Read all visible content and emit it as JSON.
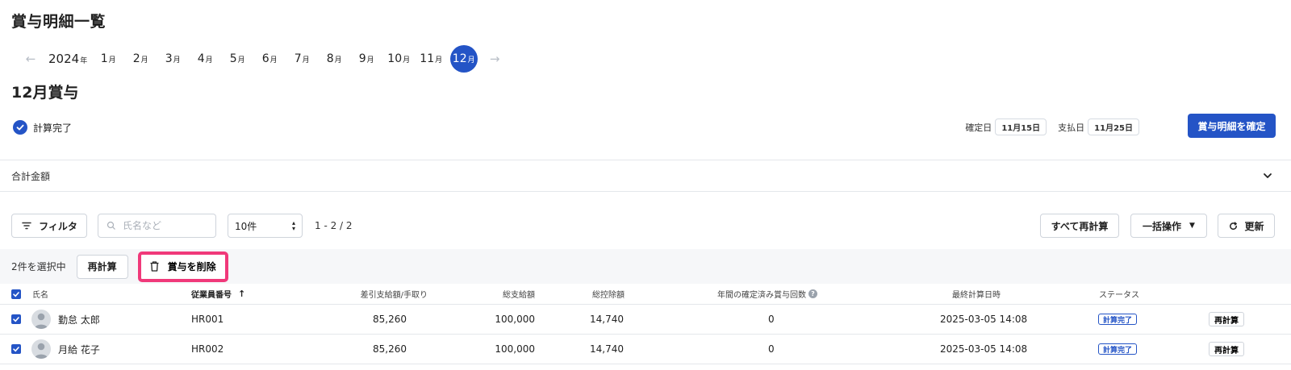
{
  "page": {
    "title": "賞与明細一覧"
  },
  "month_nav": {
    "prev_icon": "arrow-left-icon",
    "next_icon": "arrow-right-icon",
    "year": "2024",
    "year_suffix": "年",
    "month_suffix": "月",
    "months": [
      "1",
      "2",
      "3",
      "4",
      "5",
      "6",
      "7",
      "8",
      "9",
      "10",
      "11",
      "12"
    ],
    "active_month": "12"
  },
  "section": {
    "title": "12月賞与",
    "status": "計算完了",
    "confirm_date_label": "確定日",
    "confirm_date": "11月15日",
    "pay_date_label": "支払日",
    "pay_date": "11月25日",
    "confirm_button": "賞与明細を確定"
  },
  "totals": {
    "label": "合計金額"
  },
  "toolbar": {
    "filter_label": "フィルタ",
    "search_placeholder": "氏名など",
    "per_page": "10件",
    "range": "1 - 2 / 2",
    "recalc_all": "すべて再計算",
    "bulk": "一括操作",
    "refresh": "更新"
  },
  "selection": {
    "count_text": "2件を選択中",
    "recalc": "再計算",
    "delete": "賞与を削除"
  },
  "table": {
    "headers": {
      "name": "氏名",
      "employee_no": "従業員番号",
      "net_pay": "差引支給額/手取り",
      "gross": "総支給額",
      "deductions": "総控除額",
      "bonus_count": "年間の確定済み賞与回数",
      "last_calc": "最終計算日時",
      "status": "ステータス"
    },
    "rows": [
      {
        "name": "勤怠 太郎",
        "employee_no": "HR001",
        "net_pay": "85,260",
        "gross": "100,000",
        "deductions": "14,740",
        "bonus_count": "0",
        "last_calc": "2025-03-05 14:08",
        "status": "計算完了",
        "action": "再計算",
        "checked": true
      },
      {
        "name": "月給 花子",
        "employee_no": "HR002",
        "net_pay": "85,260",
        "gross": "100,000",
        "deductions": "14,740",
        "bonus_count": "0",
        "last_calc": "2025-03-05 14:08",
        "status": "計算完了",
        "action": "再計算",
        "checked": true
      }
    ]
  },
  "colors": {
    "accent": "#2454c6",
    "highlight": "#f0397a"
  }
}
